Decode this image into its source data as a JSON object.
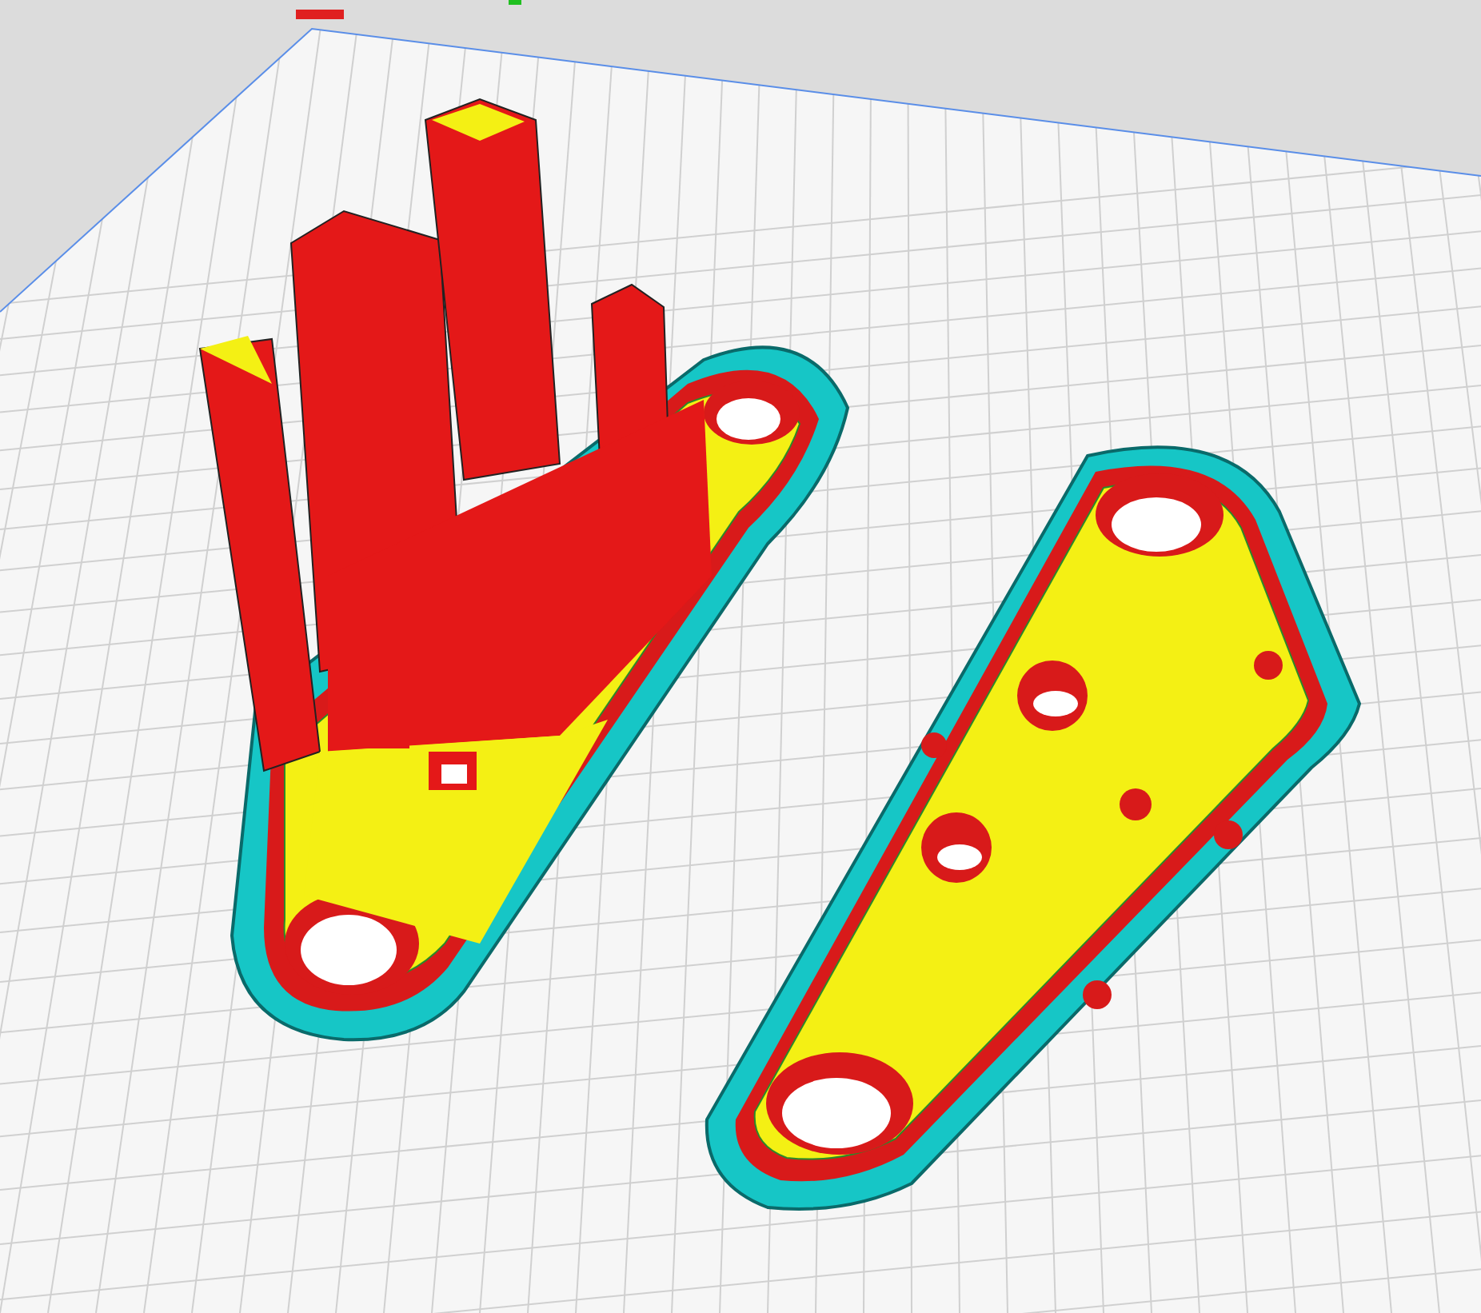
{
  "scene": {
    "kind": "layer-view"
  }
}
